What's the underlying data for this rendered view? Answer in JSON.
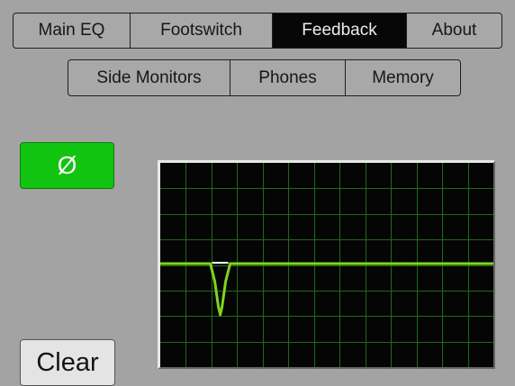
{
  "top_tabs": [
    {
      "label": "Main EQ",
      "active": false
    },
    {
      "label": "Footswitch",
      "active": false
    },
    {
      "label": "Feedback",
      "active": true
    },
    {
      "label": "About",
      "active": false
    }
  ],
  "sub_tabs": [
    {
      "label": "Side Monitors"
    },
    {
      "label": "Phones"
    },
    {
      "label": "Memory"
    }
  ],
  "phase_button": {
    "symbol": "Ø"
  },
  "clear_button": {
    "label": "Clear"
  },
  "colors": {
    "background": "#a3a3a3",
    "active_tab": "#070707",
    "phase_button": "#11c40f",
    "graph_background": "#050505",
    "graph_grid": "#1e6a1c",
    "response_line": "#7fd51f"
  },
  "feedback_notch": {
    "position_fraction": 0.18,
    "depth_fraction": 0.25
  }
}
